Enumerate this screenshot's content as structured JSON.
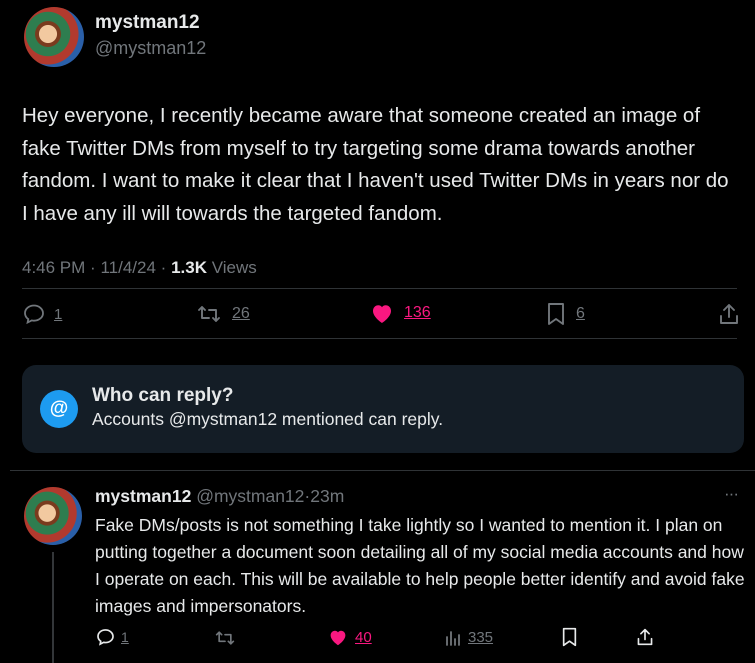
{
  "post": {
    "display_name": "mystman12",
    "handle": "@mystman12",
    "text": "Hey everyone, I recently became aware that someone created an image of fake Twitter DMs from myself to try targeting some drama towards another fandom. I want to make it clear that I haven't used Twitter DMs in years nor do I have any ill will towards the targeted fandom.",
    "time": "4:46 PM",
    "date": "11/4/24",
    "views_count": "1.3K",
    "views_label": "Views",
    "sep": "·",
    "replies": "1",
    "reposts": "26",
    "likes": "136",
    "bookmarks": "6"
  },
  "reply_restriction": {
    "icon_glyph": "@",
    "title": "Who can reply?",
    "text": "Accounts @mystman12 mentioned can reply."
  },
  "reply": {
    "display_name": "mystman12",
    "handle": "@mystman12",
    "sep": "·",
    "age": "23m",
    "more": "···",
    "text": "Fake DMs/posts is not something I take lightly so I wanted to mention it. I plan on putting together a document soon detailing all of my social media accounts and how I operate on each. This will be available to help people better identify and avoid fake images and impersonators.",
    "replies": "1",
    "likes": "40",
    "views": "335"
  },
  "colors": {
    "background": "#000000",
    "text": "#e7e9ea",
    "muted": "#71767b",
    "like": "#f91880",
    "accent": "#1d9bf0",
    "box": "#141d26"
  }
}
